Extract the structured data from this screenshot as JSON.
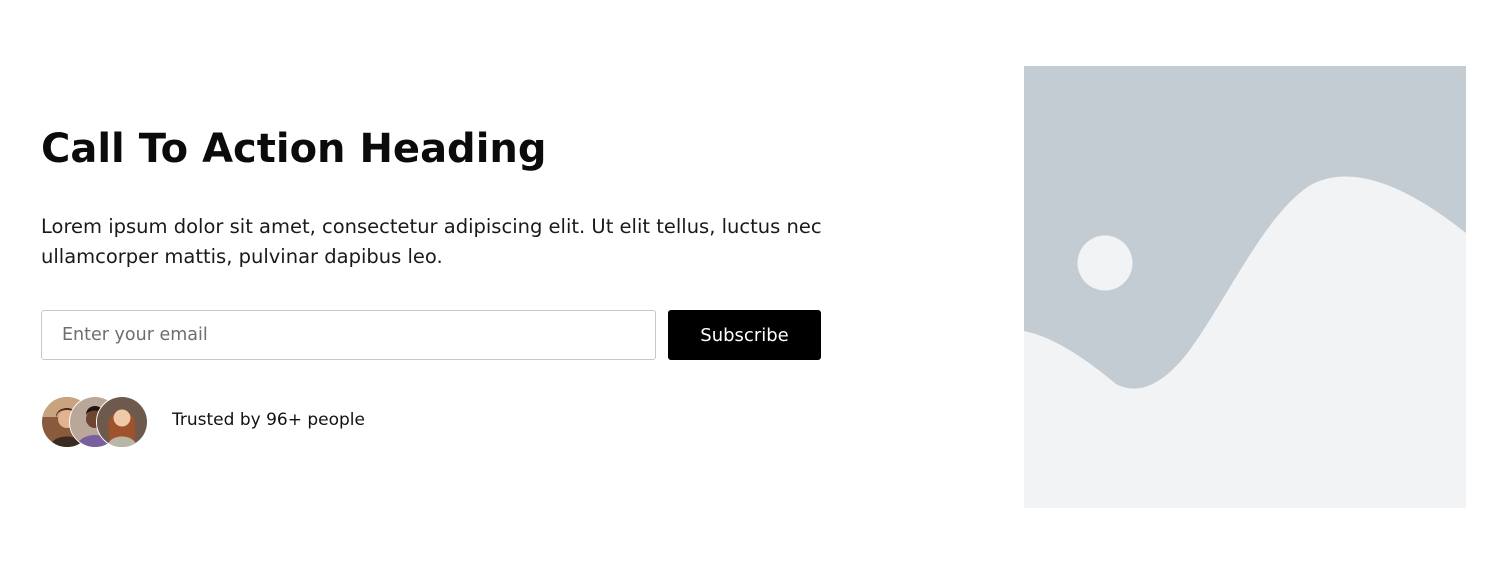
{
  "cta": {
    "heading": "Call To Action Heading",
    "body": "Lorem ipsum dolor sit amet, consectetur adipiscing elit. Ut elit tellus, luctus nec ullamcorper mattis, pulvinar dapibus leo."
  },
  "form": {
    "email_placeholder": "Enter your email",
    "email_value": "",
    "subscribe_label": "Subscribe"
  },
  "trust": {
    "text": "Trusted by 96+ people",
    "avatar_count": 3
  },
  "icons": {
    "avatars": "user-avatar-photo",
    "image": "image-placeholder-icon"
  },
  "colors": {
    "button_bg": "#000000",
    "button_text": "#ffffff",
    "placeholder_bg": "#c4ccd3",
    "placeholder_fg": "#f1f3f4",
    "input_border": "#c8c8c8"
  }
}
